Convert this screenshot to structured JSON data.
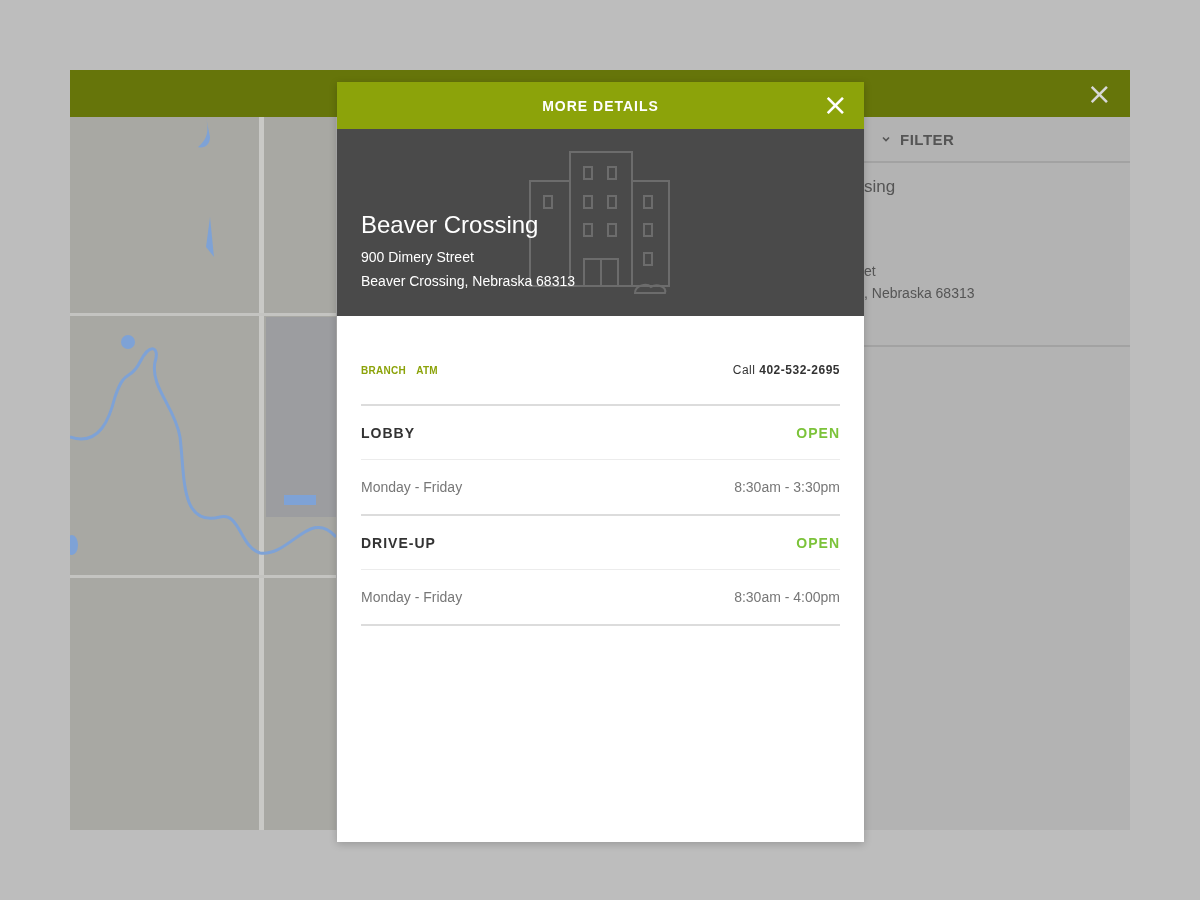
{
  "background_panel": {
    "close_label": "×",
    "filter_label": "FILTER",
    "result": {
      "name_fragment": "sing",
      "street_fragment": "et",
      "city_fragment": ", Nebraska 68313"
    }
  },
  "modal": {
    "title": "MORE DETAILS",
    "close_label": "×",
    "location": {
      "name": "Beaver Crossing",
      "street": "900 Dimery Street",
      "city": "Beaver Crossing, Nebraska 68313"
    },
    "tags": [
      "BRANCH",
      "ATM"
    ],
    "phone": "Call **402-532-2695**",
    "sections": [
      {
        "name": "LOBBY",
        "status": "OPEN",
        "open": true,
        "days": "Monday - Friday",
        "hours": "8:30am - 3:30pm"
      },
      {
        "name": "DRIVE-UP",
        "status": "OPEN",
        "open": true,
        "days": "Monday - Friday",
        "hours": "8:30am - 4:00pm"
      }
    ]
  }
}
